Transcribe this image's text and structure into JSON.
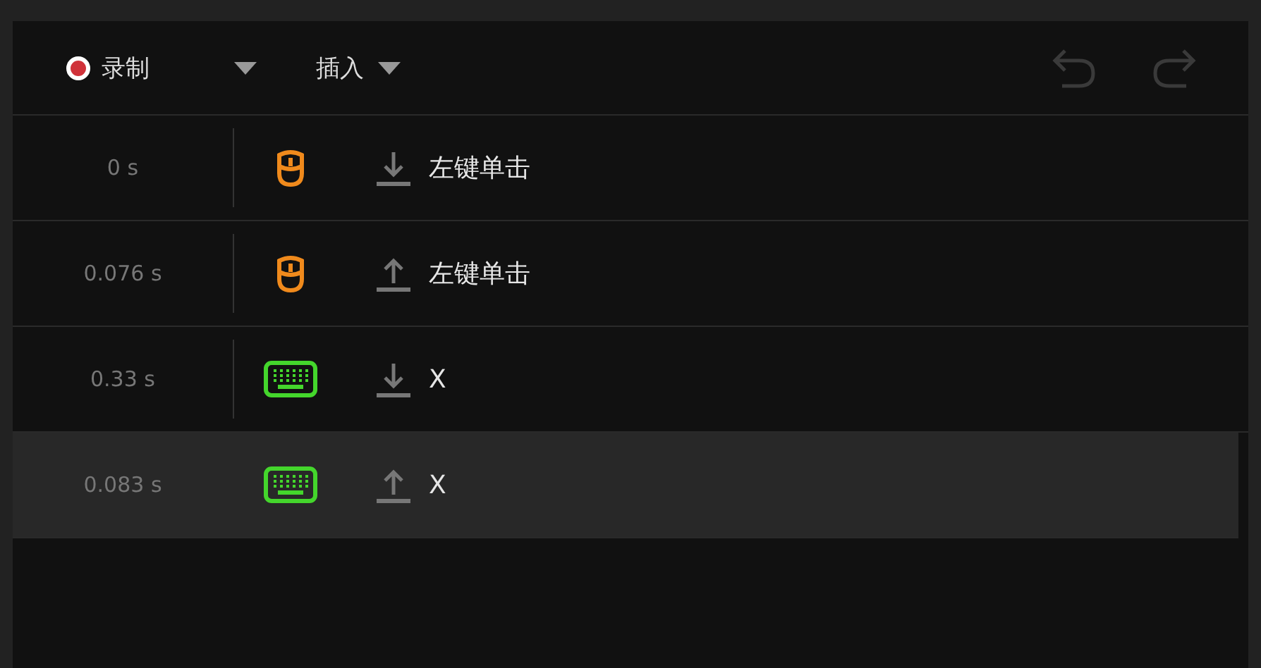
{
  "toolbar": {
    "record_label": "录制",
    "insert_label": "插入",
    "undo_disabled": true,
    "redo_disabled": true
  },
  "events": [
    {
      "time": "0 s",
      "kind": "mouse",
      "released": false,
      "label": "左键单击",
      "selected": false
    },
    {
      "time": "0.076 s",
      "kind": "mouse",
      "released": true,
      "label": "左键单击",
      "selected": false
    },
    {
      "time": "0.33 s",
      "kind": "keyboard",
      "released": false,
      "label": "X",
      "selected": false
    },
    {
      "time": "0.083 s",
      "kind": "keyboard",
      "released": true,
      "label": "X",
      "selected": true
    }
  ]
}
